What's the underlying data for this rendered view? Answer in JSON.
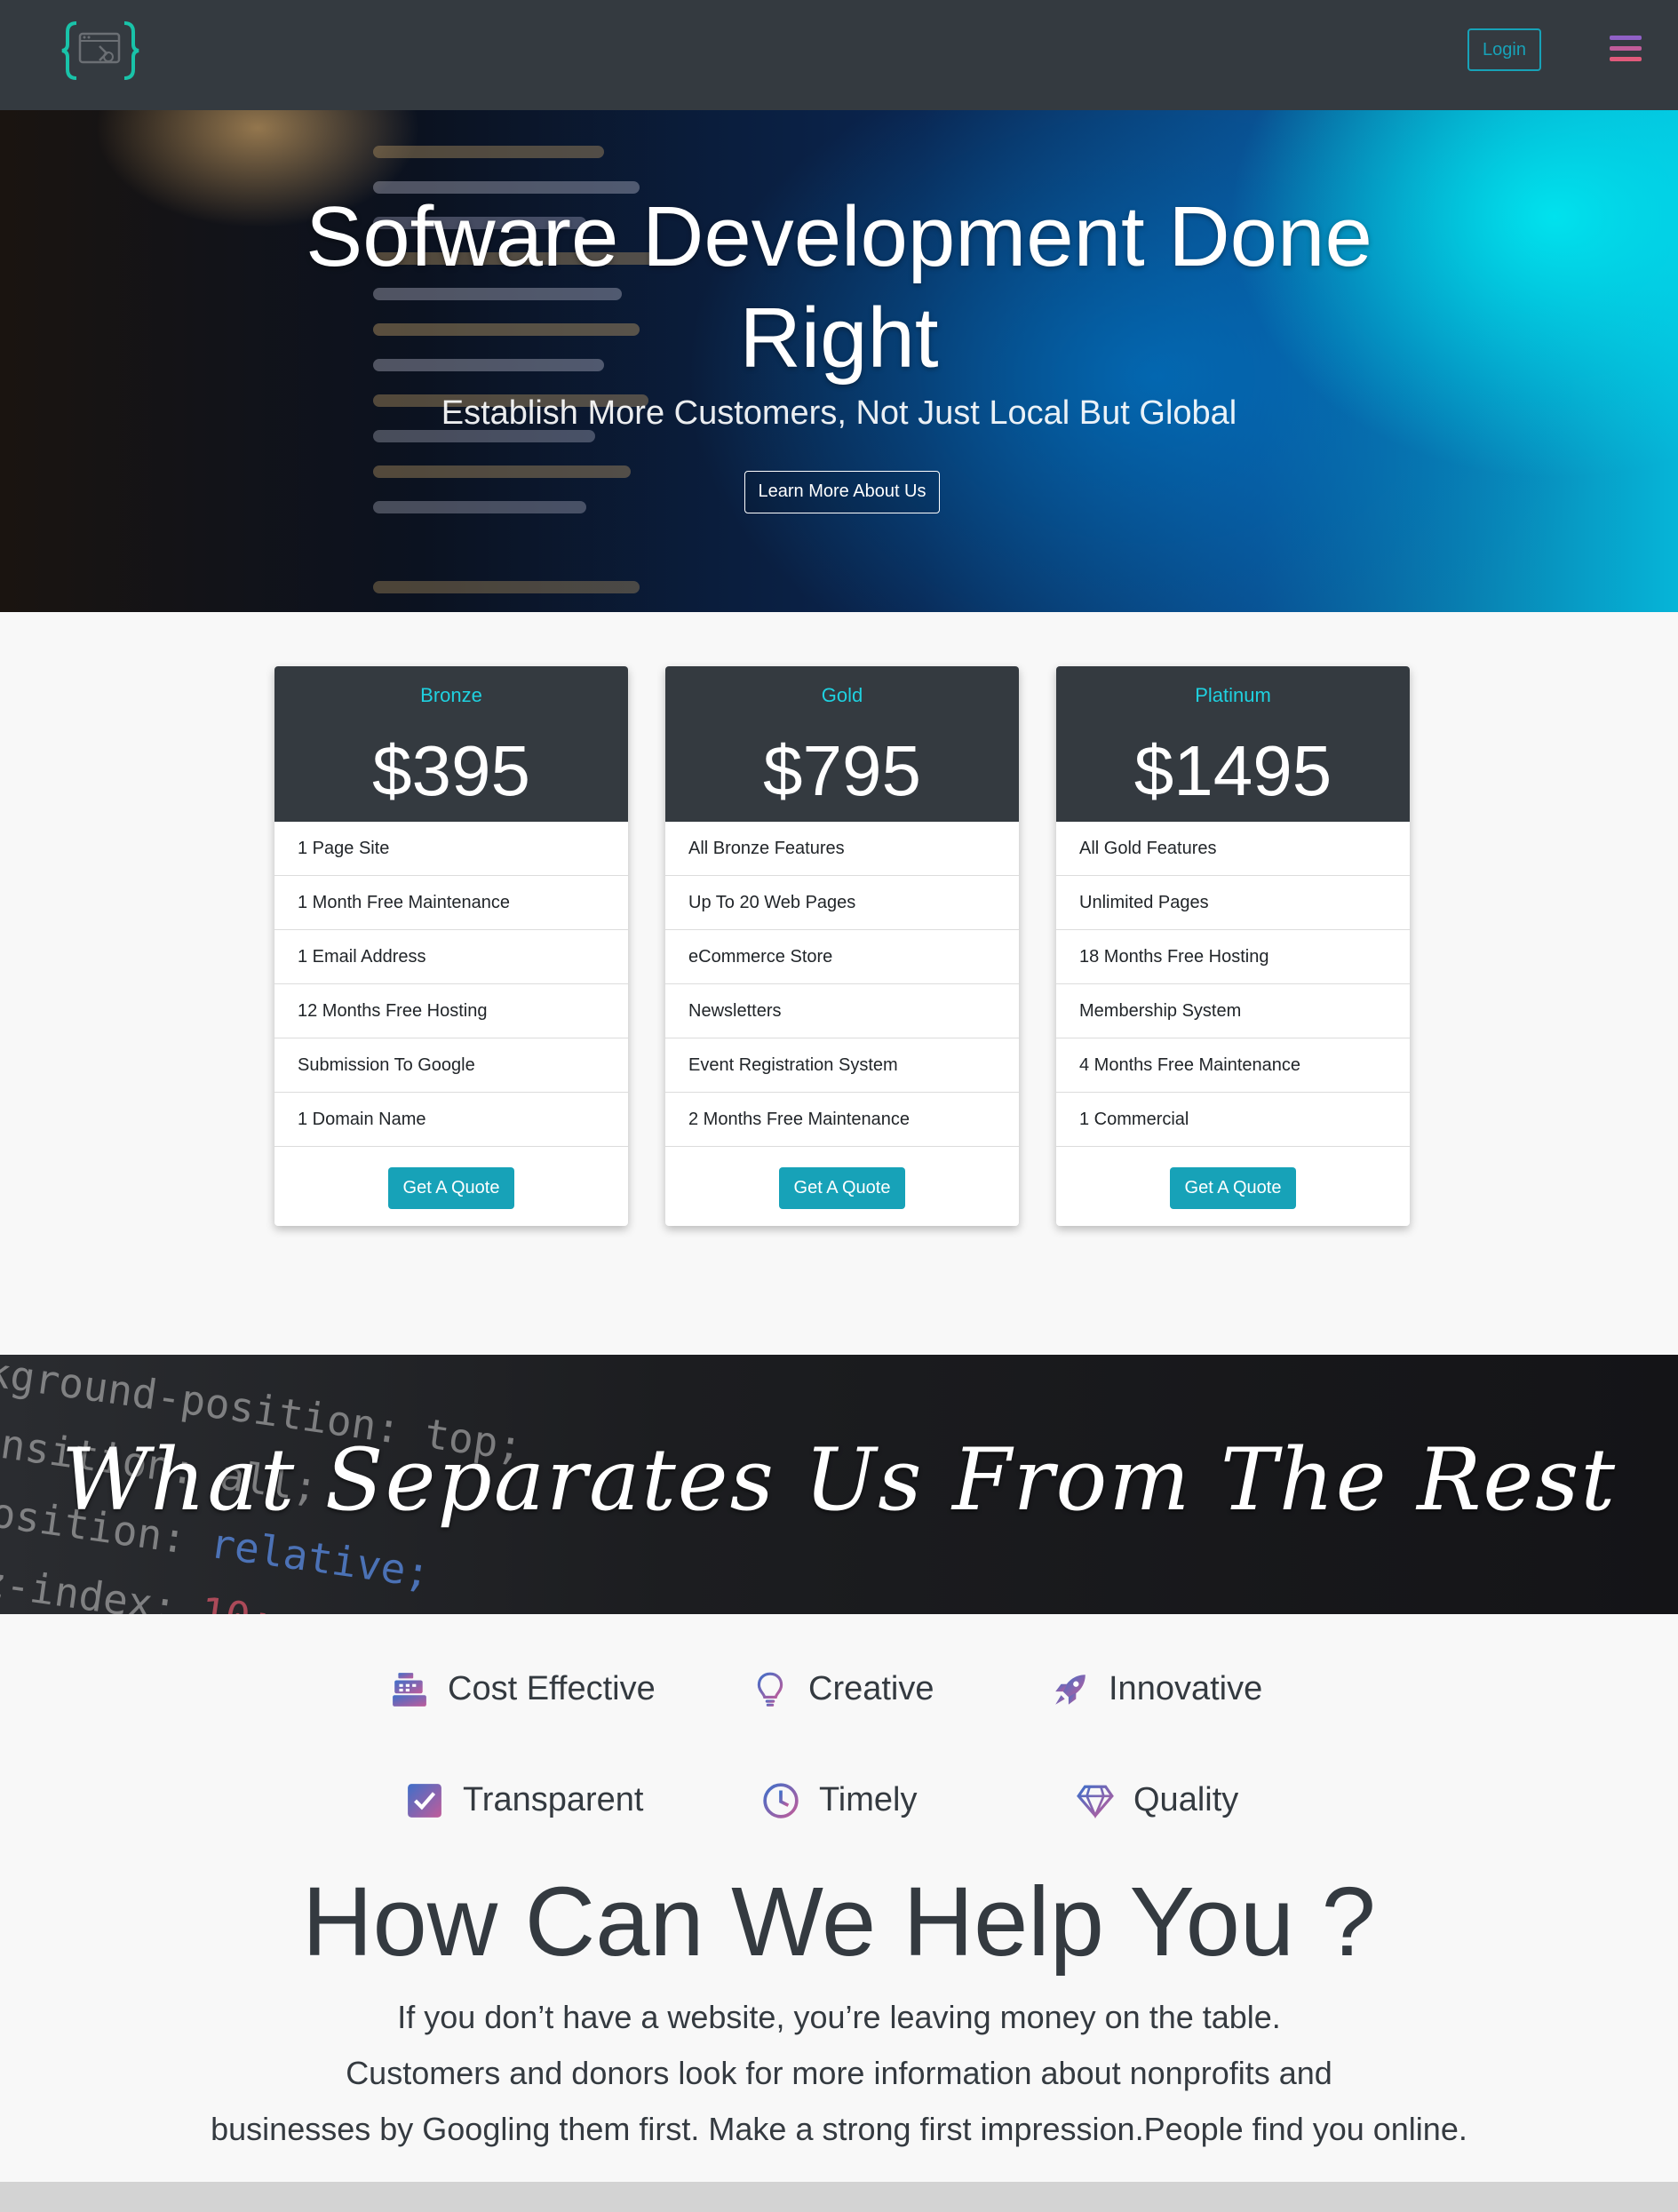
{
  "header": {
    "logo_alt": "code brackets logo",
    "login_label": "Login",
    "menu_icon": "hamburger-menu-icon"
  },
  "hero": {
    "title": "Sofware Development Done Right",
    "subtitle": "Establish More Customers, Not Just Local But Global",
    "button_label": "Learn More About Us"
  },
  "pricing": {
    "plans": [
      {
        "name": "Bronze",
        "price": "$395",
        "features": [
          "1 Page Site",
          "1 Month Free Maintenance",
          "1 Email Address",
          "12 Months Free Hosting",
          "Submission To Google",
          "1 Domain Name"
        ],
        "button_label": "Get A Quote"
      },
      {
        "name": "Gold",
        "price": "$795",
        "features": [
          "All Bronze Features",
          "Up To 20 Web Pages",
          "eCommerce Store",
          "Newsletters",
          "Event Registration System",
          "2 Months Free Maintenance"
        ],
        "button_label": "Get A Quote"
      },
      {
        "name": "Platinum",
        "price": "$1495",
        "features": [
          "All Gold Features",
          "Unlimited Pages",
          "18 Months Free Hosting",
          "Membership System",
          "4 Months Free Maintenance",
          "1 Commercial"
        ],
        "button_label": "Get A Quote"
      }
    ]
  },
  "separator": {
    "title": "What Separates Us From The Rest"
  },
  "qualities": [
    {
      "label": "Cost Effective",
      "icon": "cash-register-icon"
    },
    {
      "label": "Creative",
      "icon": "lightbulb-icon"
    },
    {
      "label": "Innovative",
      "icon": "rocket-icon"
    },
    {
      "label": "Transparent",
      "icon": "checkbox-icon"
    },
    {
      "label": "Timely",
      "icon": "clock-icon"
    },
    {
      "label": "Quality",
      "icon": "diamond-icon"
    }
  ],
  "help": {
    "title": "How Can We Help You ?",
    "line1": "If you don’t have a website, you’re leaving money on the table.",
    "line2": "Customers and donors look for more information about nonprofits and",
    "line3": "businesses by Googling them first. Make a strong first impression.People find you online."
  },
  "colors": {
    "dark": "#343a40",
    "accent": "#17a2b8",
    "plan_name": "#1fd1e0",
    "icon_gradient_start": "#3f6fc9",
    "icon_gradient_end": "#c15c9a"
  }
}
